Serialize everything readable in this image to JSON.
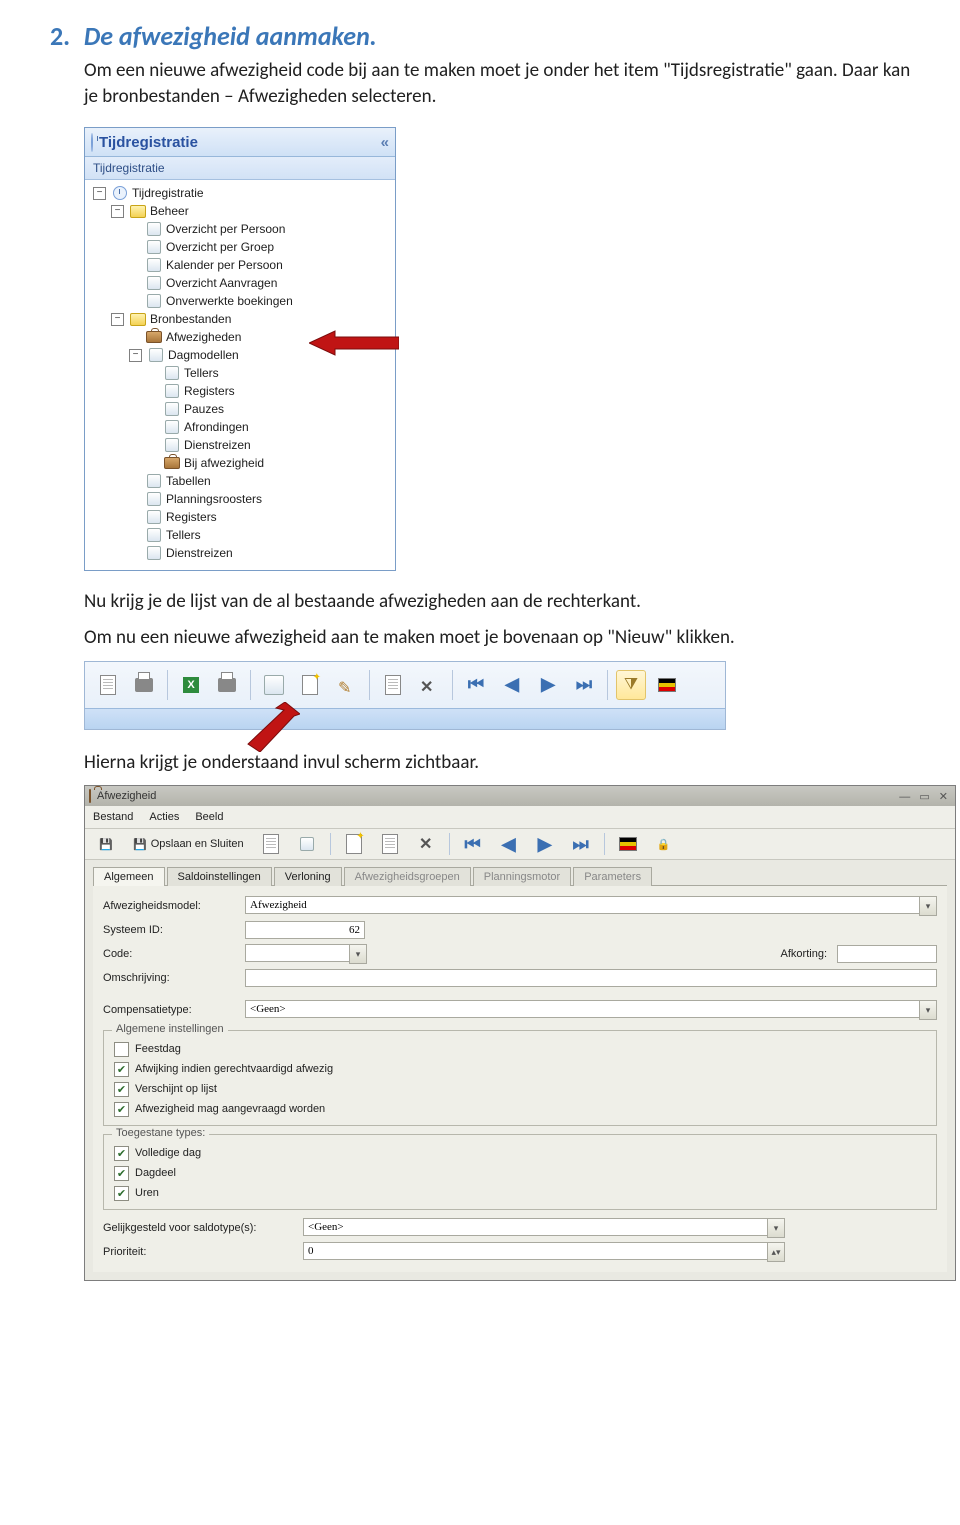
{
  "heading_num": "2.",
  "heading_text": "De afwezigheid aanmaken.",
  "para1": "Om een nieuwe afwezigheid code bij aan te maken moet je onder het item \"Tijdsregistratie\" gaan. Daar kan je bronbestanden – Afwezigheden selecteren.",
  "panel1": {
    "title": "Tijdregistratie",
    "subtitle": "Tijdregistratie",
    "tree": {
      "root": "Tijdregistratie",
      "beheer": "Beheer",
      "beheer_items": [
        "Overzicht per Persoon",
        "Overzicht per Groep",
        "Kalender per Persoon",
        "Overzicht Aanvragen",
        "Onverwerkte boekingen"
      ],
      "bron": "Bronbestanden",
      "bron_afw": "Afwezigheden",
      "dagmod": "Dagmodellen",
      "dagmod_items": [
        "Tellers",
        "Registers",
        "Pauzes",
        "Afrondingen",
        "Dienstreizen",
        "Bij afwezigheid"
      ],
      "rest": [
        "Tabellen",
        "Planningsroosters",
        "Registers",
        "Tellers",
        "Dienstreizen"
      ]
    }
  },
  "para2": "Nu krijg je de lijst van de al bestaande afwezigheden aan de rechterkant.",
  "para3": "Om nu een nieuwe afwezigheid aan te maken moet je bovenaan op \"Nieuw\" klikken.",
  "para4": "Hierna krijgt je onderstaand invul scherm zichtbaar.",
  "form": {
    "window_title": "Afwezigheid",
    "menus": [
      "Bestand",
      "Acties",
      "Beeld"
    ],
    "toolbar_save": "Opslaan en Sluiten",
    "tabs": [
      "Algemeen",
      "Saldoinstellingen",
      "Verloning",
      "Afwezigheidsgroepen",
      "Planningsmotor",
      "Parameters"
    ],
    "labels": {
      "model": "Afwezigheidsmodel:",
      "model_val": "Afwezigheid",
      "sysid": "Systeem ID:",
      "sysid_val": "62",
      "code": "Code:",
      "afk": "Afkorting:",
      "omschr": "Omschrijving:",
      "comp": "Compensatietype:",
      "comp_val": "<Geen>",
      "grp_alg": "Algemene instellingen",
      "cb_feest": "Feestdag",
      "cb_afw": "Afwijking indien gerechtvaardigd afwezig",
      "cb_lijst": "Verschijnt op lijst",
      "cb_aanvr": "Afwezigheid mag aangevraagd worden",
      "grp_types": "Toegestane types:",
      "cb_vol": "Volledige dag",
      "cb_dag": "Dagdeel",
      "cb_uren": "Uren",
      "gelijk": "Gelijkgesteld voor saldotype(s):",
      "gelijk_val": "<Geen>",
      "prio": "Prioriteit:",
      "prio_val": "0"
    }
  }
}
